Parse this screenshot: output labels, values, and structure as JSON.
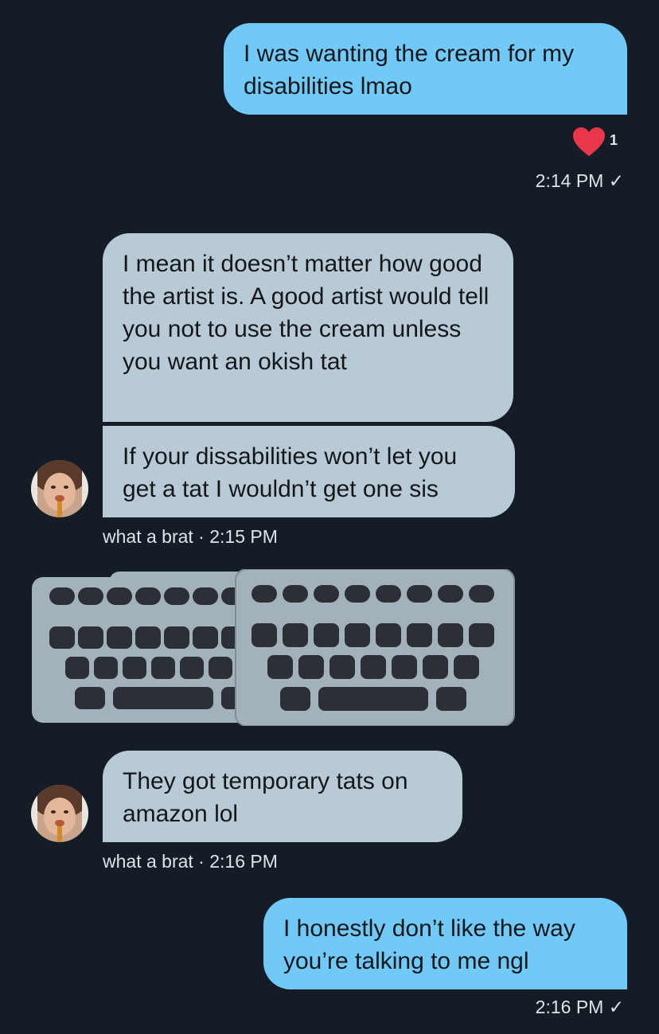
{
  "messages": [
    {
      "text": "I was wanting the cream for my disabilities lmao"
    },
    {
      "text": "I mean it doesn’t matter how good the artist is. A good artist would tell you not to use the cream unless you want an okish tat"
    },
    {
      "text": "If your dissabilities won’t let you get a tat I wouldn’t get one sis"
    },
    {
      "text": "They got temporary tats on amazon lol"
    },
    {
      "text": "I honestly don’t like the way you’re talking to me ngl"
    }
  ],
  "reaction": {
    "icon": "heart-icon",
    "count": "1",
    "color": "#e8364a"
  },
  "meta": {
    "sent_1": "2:14 PM ✓",
    "received_1": "what a brat · 2:15 PM",
    "received_2": "what a brat · 2:16 PM",
    "sent_2": "2:16 PM ✓"
  },
  "attachment": {
    "icon": "keyboard-icon"
  },
  "colors": {
    "background": "#141d26",
    "outgoing": "#71c9f8",
    "incoming": "#b8cad6"
  }
}
